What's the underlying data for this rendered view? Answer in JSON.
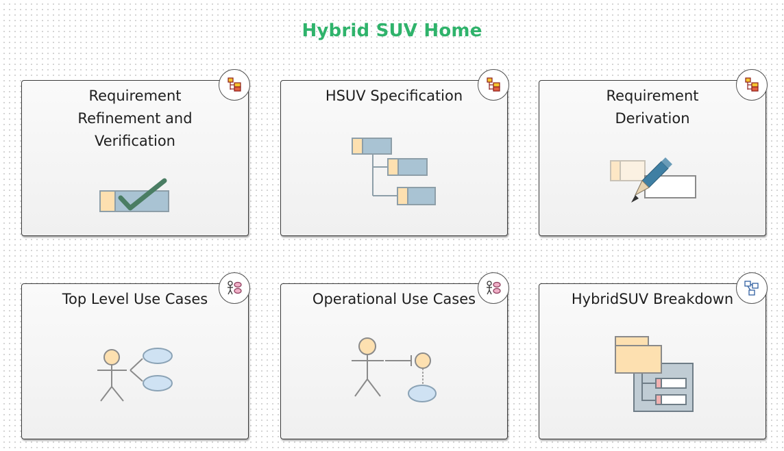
{
  "diagram": {
    "title": "Hybrid SUV Home"
  },
  "cards": [
    {
      "title": "Requirement\nRefinement and\nVerification",
      "icon": "requirement-diagram-icon",
      "art": "requirement-check-icon"
    },
    {
      "title": "HSUV Specification",
      "icon": "requirement-diagram-icon",
      "art": "requirement-tree-icon"
    },
    {
      "title": "Requirement\nDerivation",
      "icon": "requirement-diagram-icon",
      "art": "requirement-edit-icon"
    },
    {
      "title": "Top Level Use Cases",
      "icon": "use-case-diagram-icon",
      "art": "actor-use-cases-icon"
    },
    {
      "title": "Operational Use Cases",
      "icon": "use-case-diagram-icon",
      "art": "actor-interface-icon"
    },
    {
      "title": "HybridSUV Breakdown",
      "icon": "block-diagram-icon",
      "art": "package-breakdown-icon"
    }
  ],
  "colors": {
    "title": "#2fb36b",
    "requirement_tan": "#fde0b0",
    "requirement_blue": "#a9c3d3",
    "check_green": "#4a7d63",
    "use_case_blue": "#cfe2f3",
    "pencil_blue": "#3f7fa3"
  }
}
